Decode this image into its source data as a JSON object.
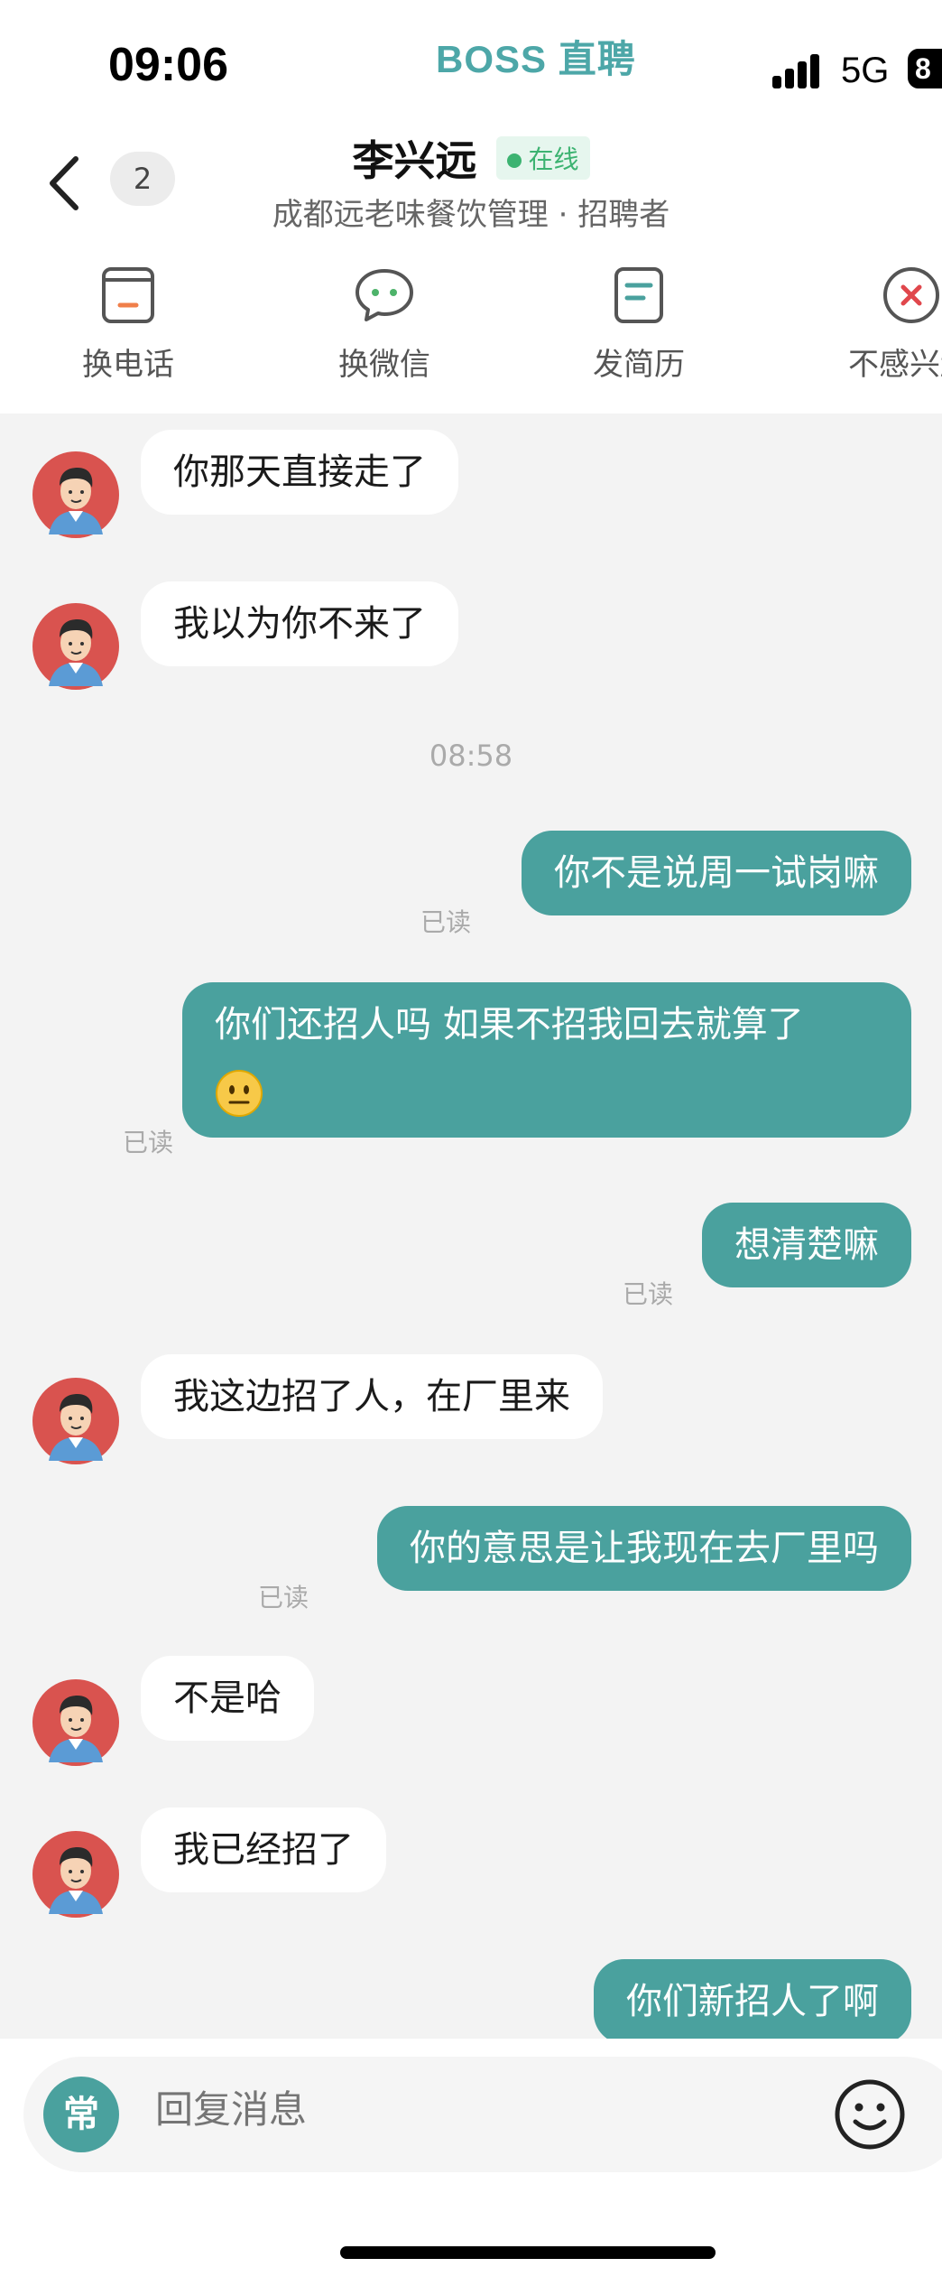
{
  "status_bar": {
    "time": "09:06",
    "app_brand": "BOSS 直聘",
    "network": "5G",
    "battery": "8"
  },
  "header": {
    "unread_count": "2",
    "contact_name": "李兴远",
    "online_status": "在线",
    "subtitle": "成都远老味餐饮管理 · 招聘者"
  },
  "actions": [
    {
      "label": "换电话",
      "icon": "phone-card-icon"
    },
    {
      "label": "换微信",
      "icon": "wechat-bubble-icon"
    },
    {
      "label": "发简历",
      "icon": "resume-icon"
    },
    {
      "label": "不感兴趣",
      "icon": "close-circle-icon"
    }
  ],
  "messages": [
    {
      "from": "recruiter",
      "text": "你那天直接走了"
    },
    {
      "from": "recruiter",
      "text": "我以为你不来了"
    },
    {
      "timestamp": "08:58"
    },
    {
      "from": "me",
      "text": "你不是说周一试岗嘛",
      "status": "已读"
    },
    {
      "from": "me",
      "text": "你们还招人吗 如果不招我回去就算了",
      "emoji": "neutral-face-emoji",
      "status": "已读"
    },
    {
      "from": "me",
      "text": "想清楚嘛",
      "status": "已读"
    },
    {
      "from": "recruiter",
      "text": "我这边招了人，在厂里来"
    },
    {
      "from": "me",
      "text": "你的意思是让我现在去厂里吗",
      "status": "已读"
    },
    {
      "from": "recruiter",
      "text": "不是哈"
    },
    {
      "from": "recruiter",
      "text": "我已经招了"
    },
    {
      "from": "me",
      "text": "你们新招人了啊"
    }
  ],
  "input": {
    "quick_reply_label": "常",
    "placeholder": "回复消息"
  },
  "colors": {
    "brand": "#4da7a8",
    "outgoing_bubble": "#4aa19e",
    "incoming_bubble": "#ffffff",
    "background": "#f3f3f3",
    "online": "#3cb371",
    "danger": "#e0474c"
  }
}
